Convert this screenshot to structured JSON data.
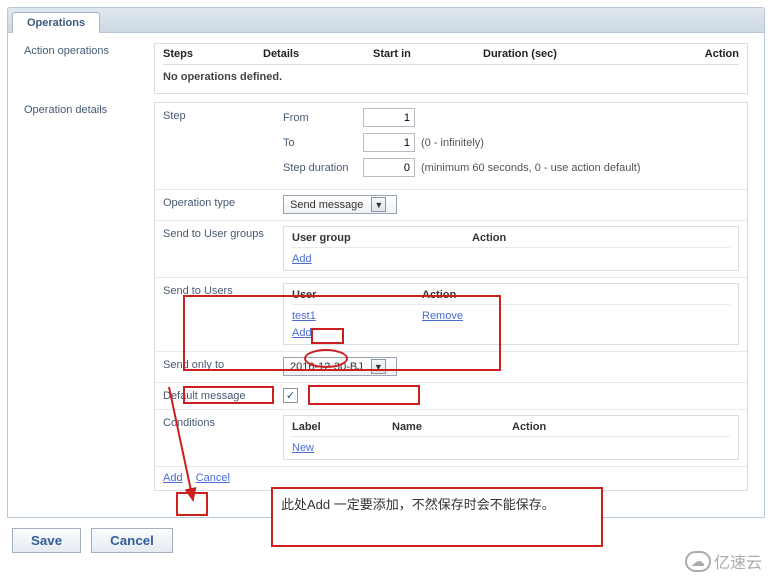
{
  "tab": {
    "label": "Operations"
  },
  "action_operations": {
    "label": "Action operations",
    "headers": {
      "steps": "Steps",
      "details": "Details",
      "start": "Start in",
      "duration": "Duration (sec)",
      "action": "Action"
    },
    "empty": "No operations defined."
  },
  "operation_details": {
    "label": "Operation details",
    "step": {
      "label": "Step",
      "from_label": "From",
      "from_value": "1",
      "to_label": "To",
      "to_value": "1",
      "to_hint": "(0 - infinitely)",
      "duration_label": "Step duration",
      "duration_value": "0",
      "duration_hint": "(minimum 60 seconds, 0 - use action default)"
    },
    "op_type": {
      "label": "Operation type",
      "value": "Send message"
    },
    "user_groups": {
      "label": "Send to User groups",
      "headers": {
        "group": "User group",
        "action": "Action"
      },
      "add": "Add"
    },
    "users": {
      "label": "Send to Users",
      "headers": {
        "user": "User",
        "action": "Action"
      },
      "rows": [
        {
          "user": "test1",
          "action": "Remove"
        }
      ],
      "add": "Add"
    },
    "send_only": {
      "label": "Send only to",
      "value": "2016-12-30-BJ"
    },
    "default_message": {
      "label": "Default message",
      "checked": true
    },
    "conditions": {
      "label": "Conditions",
      "headers": {
        "label": "Label",
        "name": "Name",
        "action": "Action"
      },
      "new": "New"
    },
    "footer": {
      "add": "Add",
      "cancel": "Cancel"
    }
  },
  "bottom": {
    "save": "Save",
    "cancel": "Cancel"
  },
  "annotation": {
    "note": "此处Add 一定要添加，不然保存时会不能保存。"
  },
  "watermark": {
    "text": "亿速云"
  }
}
